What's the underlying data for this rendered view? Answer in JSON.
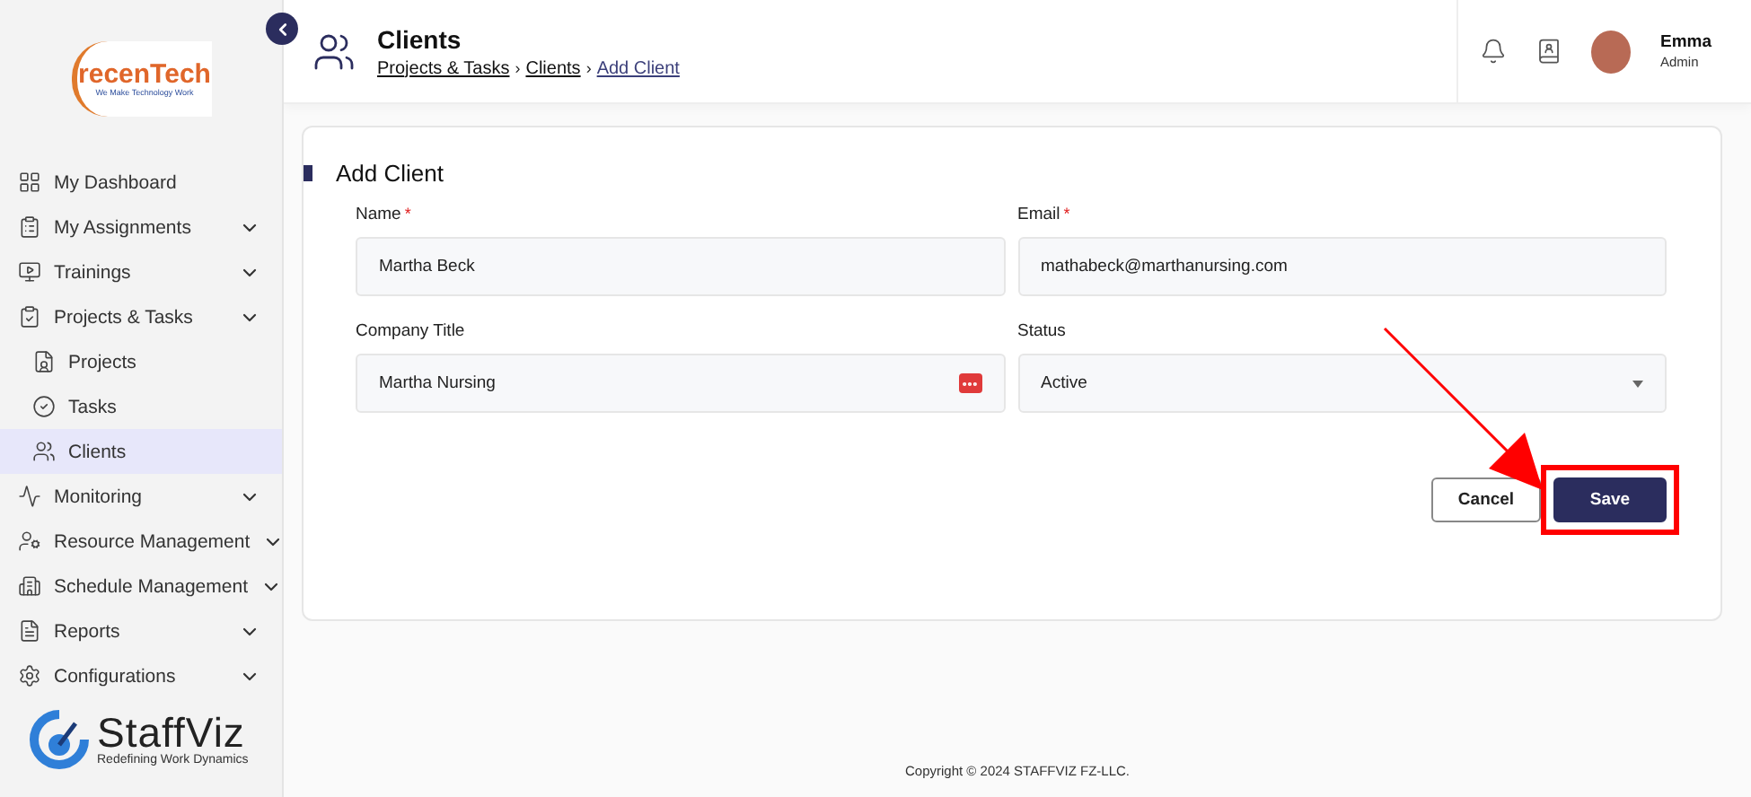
{
  "sidebar": {
    "logo": {
      "name": "recenTech",
      "tagline": "We Make Technology Work"
    },
    "items": [
      {
        "label": "My Dashboard",
        "kind": "link",
        "selected": false
      },
      {
        "label": "My Assignments",
        "kind": "group",
        "selected": false
      },
      {
        "label": "Trainings",
        "kind": "group",
        "selected": false
      },
      {
        "label": "Projects & Tasks",
        "kind": "group",
        "selected": false,
        "children": [
          {
            "label": "Projects",
            "selected": false
          },
          {
            "label": "Tasks",
            "selected": false
          },
          {
            "label": "Clients",
            "selected": true
          }
        ]
      },
      {
        "label": "Monitoring",
        "kind": "group",
        "selected": false
      },
      {
        "label": "Resource Management",
        "kind": "group",
        "selected": false
      },
      {
        "label": "Schedule Management",
        "kind": "group",
        "selected": false
      },
      {
        "label": "Reports",
        "kind": "group",
        "selected": false
      },
      {
        "label": "Configurations",
        "kind": "group",
        "selected": false
      }
    ],
    "brand": {
      "name": "StaffViz",
      "tagline": "Redefining Work Dynamics"
    }
  },
  "header": {
    "title": "Clients",
    "breadcrumb": [
      {
        "label": "Projects & Tasks",
        "current": false
      },
      {
        "separator": "›",
        "label": "Clients",
        "current": false
      },
      {
        "separator": "›",
        "label": "Add Client",
        "current": true
      }
    ],
    "user": {
      "name": "Emma",
      "role": "Admin"
    }
  },
  "form": {
    "title": "Add Client",
    "fields": [
      {
        "label": "Name",
        "required_mark": "*",
        "kind": "text",
        "value": "Martha Beck",
        "autofill_icon": false
      },
      {
        "label": "Email",
        "required_mark": "*",
        "kind": "text",
        "value": "mathabeck@marthanursing.com",
        "autofill_icon": false
      },
      {
        "label": "Company Title",
        "kind": "text",
        "value": "Martha Nursing",
        "autofill_icon": true
      },
      {
        "label": "Status",
        "kind": "select",
        "value": "Active",
        "autofill_icon": false
      }
    ],
    "buttons": [
      {
        "label": "Cancel",
        "kind": "secondary",
        "highlighted": false
      },
      {
        "label": "Save",
        "kind": "primary",
        "highlighted": true
      }
    ]
  },
  "footer": {
    "copyright": "Copyright © 2024 STAFFVIZ FZ-LLC."
  }
}
